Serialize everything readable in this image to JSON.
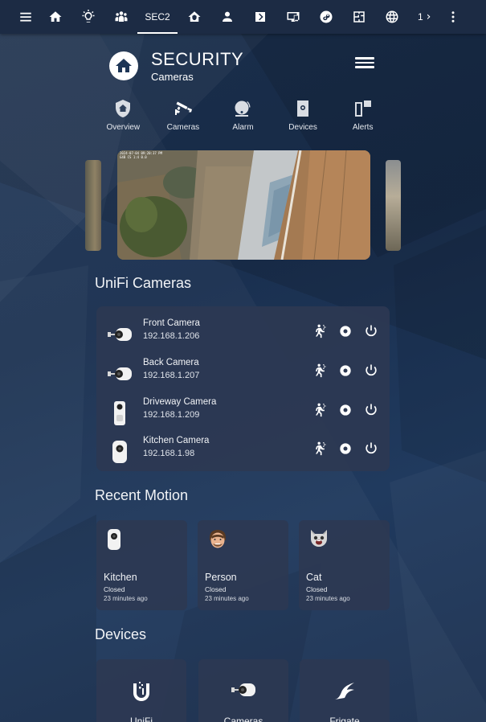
{
  "topnav": {
    "items": [
      {
        "icon": "menu-icon"
      },
      {
        "icon": "home-icon"
      },
      {
        "icon": "lightbulb-icon"
      },
      {
        "icon": "people-group-icon"
      },
      {
        "label": "SEC2",
        "active": true
      },
      {
        "icon": "home-security-icon"
      },
      {
        "icon": "person-icon"
      },
      {
        "icon": "chevron-box-icon"
      },
      {
        "icon": "monitor-device-icon"
      },
      {
        "icon": "circle-swirl-icon"
      },
      {
        "icon": "floorplan-icon"
      },
      {
        "icon": "globe-icon"
      }
    ],
    "overflow_label": "1",
    "overflow_chevron": "›"
  },
  "header": {
    "title": "SECURITY",
    "subtitle": "Cameras"
  },
  "subtabs": [
    {
      "label": "Overview",
      "icon": "shield-home-icon"
    },
    {
      "label": "Cameras",
      "icon": "cctv-icon"
    },
    {
      "label": "Alarm",
      "icon": "alarm-bell-icon"
    },
    {
      "label": "Devices",
      "icon": "device-icon"
    },
    {
      "label": "Alerts",
      "icon": "alerts-icon"
    }
  ],
  "carousel": {
    "stamp_line1": "2024-07-04 09:20:37 PM",
    "stamp_line2": "G4B CS 1:4 0.0"
  },
  "unifi_cameras": {
    "title": "UniFi Cameras",
    "cameras": [
      {
        "name": "Front Camera",
        "ip": "192.168.1.206",
        "type": "bullet"
      },
      {
        "name": "Back Camera",
        "ip": "192.168.1.207",
        "type": "bullet"
      },
      {
        "name": "Driveway Camera",
        "ip": "192.168.1.209",
        "type": "doorbell"
      },
      {
        "name": "Kitchen Camera",
        "ip": "192.168.1.98",
        "type": "instant"
      }
    ]
  },
  "recent_motion": {
    "title": "Recent Motion",
    "items": [
      {
        "name": "Kitchen",
        "state": "Closed",
        "time": "23 minutes ago",
        "icon": "camera-instant-icon"
      },
      {
        "name": "Person",
        "state": "Closed",
        "time": "23 minutes ago",
        "icon": "person-emoji-icon"
      },
      {
        "name": "Cat",
        "state": "Closed",
        "time": "23 minutes ago",
        "icon": "cat-emoji-icon"
      }
    ]
  },
  "devices": {
    "title": "Devices",
    "items": [
      {
        "label": "UniFi",
        "icon": "unifi-logo-icon"
      },
      {
        "label": "Cameras",
        "icon": "bullet-camera-icon"
      },
      {
        "label": "Frigate",
        "icon": "frigate-bird-icon"
      }
    ]
  },
  "colors": {
    "background": "#1a2f4d",
    "topbar": "#1c2b44",
    "card": "#2c3852"
  }
}
